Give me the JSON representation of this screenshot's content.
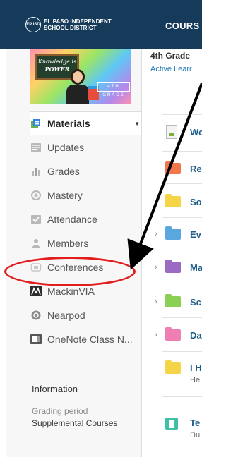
{
  "header": {
    "logo_mark": "EP ISD",
    "logo_line1": "EL PASO INDEPENDENT",
    "logo_line2": "SCHOOL DISTRICT",
    "courses_label": "COURS"
  },
  "course": {
    "image": {
      "chalkboard_line1": "Knowledge is",
      "chalkboard_line2": "POWER",
      "banner_text": "4TH GRADE"
    },
    "title": "4th Grade",
    "subtitle": "Active Learr"
  },
  "sidebar": {
    "items": [
      {
        "label": "Materials",
        "icon": "materials-icon",
        "active": true
      },
      {
        "label": "Updates",
        "icon": "updates-icon"
      },
      {
        "label": "Grades",
        "icon": "grades-icon"
      },
      {
        "label": "Mastery",
        "icon": "mastery-icon"
      },
      {
        "label": "Attendance",
        "icon": "attendance-icon"
      },
      {
        "label": "Members",
        "icon": "members-icon"
      },
      {
        "label": "Conferences",
        "icon": "conferences-icon"
      },
      {
        "label": "MackinVIA",
        "icon": "mackinvia-icon"
      },
      {
        "label": "Nearpod",
        "icon": "nearpod-icon"
      },
      {
        "label": "OneNote Class N...",
        "icon": "onenote-icon"
      }
    ],
    "information": {
      "heading": "Information",
      "grading_label": "Grading period",
      "grading_value": "Supplemental Courses"
    }
  },
  "materials": [
    {
      "label": "Wo",
      "type": "document",
      "color": "#7fb03a"
    },
    {
      "label": "Re",
      "type": "folder",
      "color": "#f2784b"
    },
    {
      "label": "So",
      "type": "folder",
      "color": "#f5d547"
    },
    {
      "label": "Ev",
      "type": "folder",
      "color": "#5aa7e0",
      "expandable": true
    },
    {
      "label": "Ma",
      "type": "folder",
      "color": "#9b6bc4",
      "expandable": true
    },
    {
      "label": "Sc",
      "type": "folder",
      "color": "#8bcf55",
      "expandable": true
    },
    {
      "label": "Da",
      "type": "folder",
      "color": "#ef7fb3",
      "expandable": true
    },
    {
      "label": "I H",
      "sub": "He",
      "type": "folder",
      "color": "#f5d547"
    },
    {
      "label": "Te",
      "sub": "Du",
      "type": "assessment",
      "color": "#3fbfa6"
    }
  ],
  "colors": {
    "header_bg": "#163a59",
    "annotation": "#e21d1d",
    "link": "#1f7ab5"
  }
}
